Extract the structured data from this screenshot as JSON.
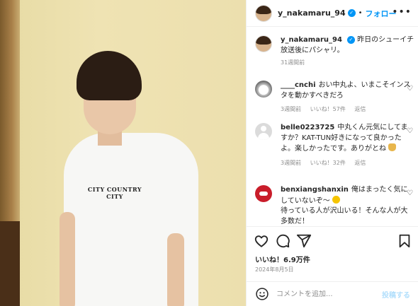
{
  "photo": {
    "shirt_print": "CITY COUNTRY CITY"
  },
  "post": {
    "username": "y_nakamaru_94",
    "follow_label": "フォロー",
    "separator": "•",
    "more_label": "•••",
    "caption": "昨日のシューイチ放送後にパシャリ。",
    "caption_age": "31週間前",
    "likes_label": "いいね！6.9万件",
    "date": "2024年8月5日"
  },
  "comments": [
    {
      "username": "____cnchi",
      "text": "おい中丸よ、いまこそインスタを動かすべきだろ",
      "age": "3週間前",
      "likes": "いいね！57件",
      "reply": "返信"
    },
    {
      "username": "belle0223725",
      "text": "中丸くん元気にしてますか？KAT-TUN好きになって良かったよ。楽しかったです。ありがとね",
      "age": "3週間前",
      "likes": "いいね！32件",
      "reply": "返信"
    },
    {
      "username": "benxiangshanxin",
      "text1": "俺はまったく気にしていないぞ〜",
      "text2": "待っている人が沢山いる！そんな人が大多数だ！"
    }
  ],
  "composer": {
    "placeholder": "コメントを追加...",
    "post_label": "投稿する"
  },
  "colors": {
    "accent": "#0095f6",
    "muted": "#8e8e8e",
    "post_disabled": "#b2dffc"
  },
  "icons": [
    "heart-icon",
    "comment-icon",
    "share-icon",
    "bookmark-icon",
    "emoji-icon",
    "more-icon",
    "verified-icon"
  ]
}
